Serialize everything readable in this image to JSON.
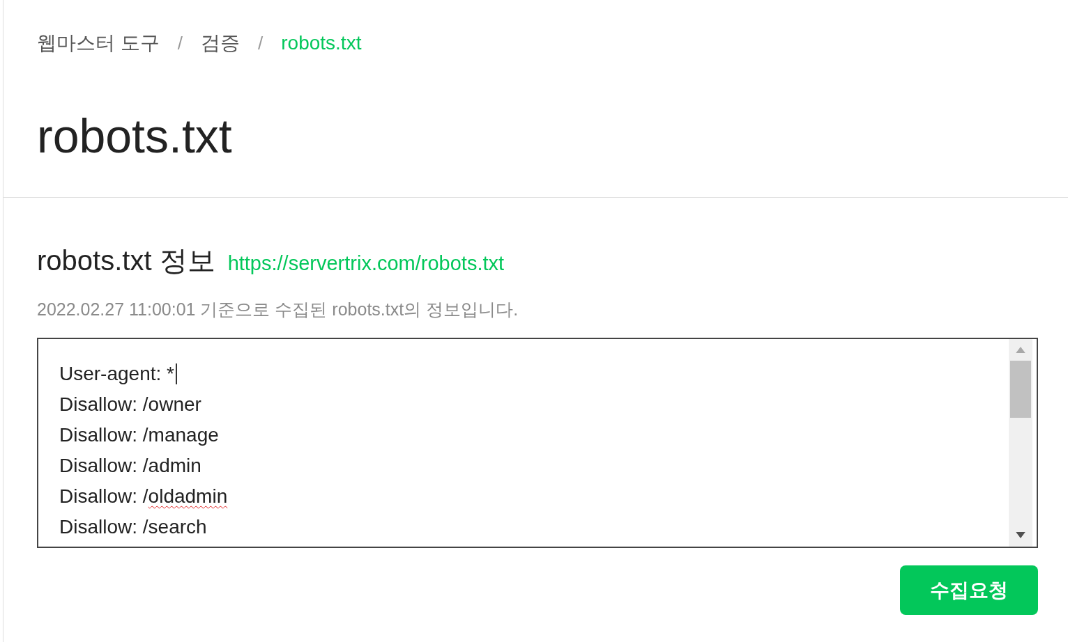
{
  "breadcrumb": {
    "items": [
      {
        "label": "웹마스터 도구",
        "current": false,
        "separator": "/"
      },
      {
        "label": "검증",
        "current": false,
        "separator": "/"
      },
      {
        "label": "robots.txt",
        "current": true
      }
    ]
  },
  "page_title": "robots.txt",
  "section": {
    "heading": "robots.txt 정보",
    "url": "https://servertrix.com/robots.txt",
    "note": "2022.02.27 11:00:01 기준으로 수집된 robots.txt의 정보입니다.",
    "editor": {
      "lines": [
        {
          "parts": [
            {
              "text": "User-agent: *",
              "misspelled": false
            }
          ],
          "caret": true
        },
        {
          "parts": [
            {
              "text": "Disallow: /owner",
              "misspelled": false
            }
          ],
          "caret": false
        },
        {
          "parts": [
            {
              "text": "Disallow: /manage",
              "misspelled": false
            }
          ],
          "caret": false
        },
        {
          "parts": [
            {
              "text": "Disallow: /admin",
              "misspelled": false
            }
          ],
          "caret": false
        },
        {
          "parts": [
            {
              "text": "Disallow: /",
              "misspelled": false
            },
            {
              "text": "oldadmin",
              "misspelled": true
            }
          ],
          "caret": false
        },
        {
          "parts": [
            {
              "text": "Disallow: /search",
              "misspelled": false
            }
          ],
          "caret": false
        }
      ]
    }
  },
  "submit_button": "수집요청"
}
